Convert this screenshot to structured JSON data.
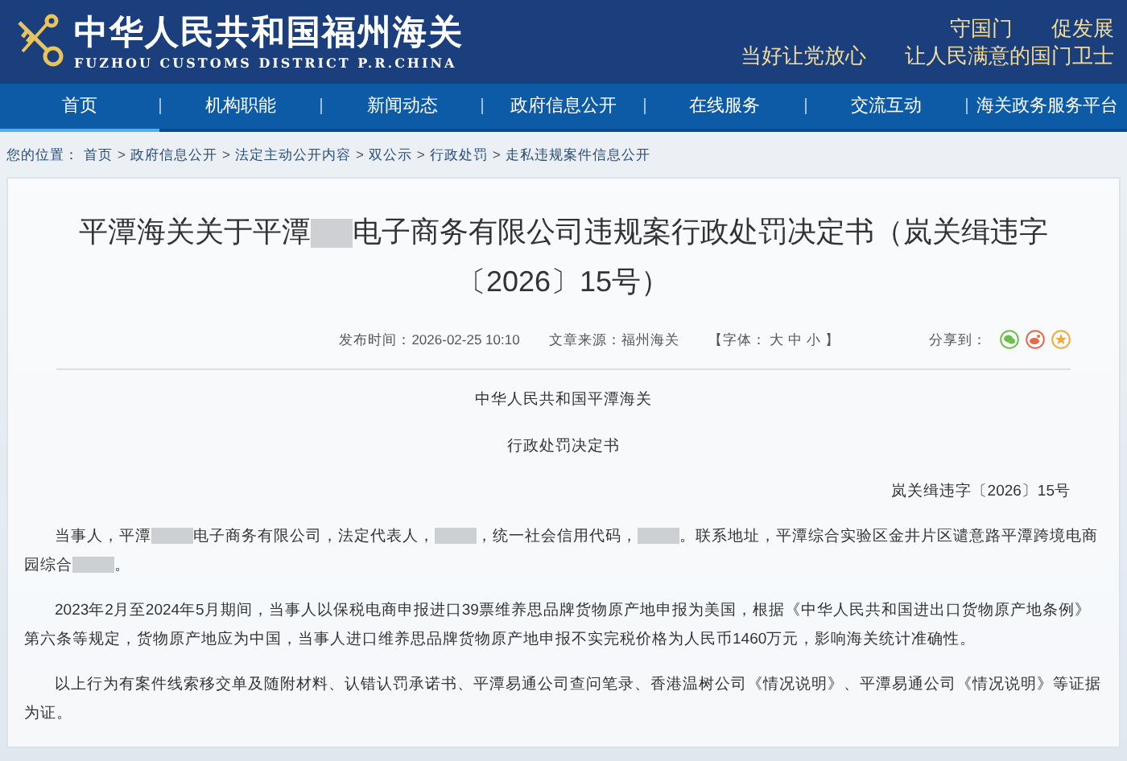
{
  "header": {
    "title": "中华人民共和国福州海关",
    "subtitle": "FUZHOU CUSTOMS DISTRICT P.R.CHINA",
    "slogans": [
      [
        "守国门",
        "促发展"
      ],
      [
        "当好让党放心",
        "让人民满意的国门卫士"
      ]
    ]
  },
  "nav": [
    {
      "label": "首页",
      "selected": true
    },
    {
      "label": "机构职能",
      "selected": false
    },
    {
      "label": "新闻动态",
      "selected": false
    },
    {
      "label": "政府信息公开",
      "selected": false
    },
    {
      "label": "在线服务",
      "selected": false
    },
    {
      "label": "交流互动",
      "selected": false
    },
    {
      "label": "海关政务服务平台",
      "selected": false
    }
  ],
  "breadcrumb": {
    "prefix": "您的位置：",
    "separator": ">",
    "items": [
      "首页",
      "政府信息公开",
      "法定主动公开内容",
      "双公示",
      "行政处罚",
      "走私违规案件信息公开"
    ]
  },
  "article": {
    "title": [
      {
        "kind": "text",
        "text": "平潭海关关于平潭"
      },
      {
        "kind": "redacted"
      },
      {
        "kind": "text",
        "text": "电子商务有限公司违规案行政处罚决定书（岚关缉违字〔2026〕15号）"
      }
    ],
    "meta": {
      "published": "发布时间：2026-02-25 10:10",
      "source": "文章来源：福州海关",
      "font_size": "【字体： 大 中 小 】",
      "share": "分享到："
    },
    "heading_lines": [
      "中华人民共和国平潭海关",
      "行政处罚决定书"
    ],
    "doc_number": "岚关缉违字〔2026〕15号",
    "paragraphs": [
      [
        {
          "kind": "text",
          "text": "当事人，平潭"
        },
        {
          "kind": "redacted"
        },
        {
          "kind": "text",
          "text": "电子商务有限公司，法定代表人，"
        },
        {
          "kind": "redacted"
        },
        {
          "kind": "text",
          "text": "，统一社会信用代码，"
        },
        {
          "kind": "redacted"
        },
        {
          "kind": "text",
          "text": "。联系地址，平潭综合实验区金井片区谴意路平潭跨境电商园综合"
        },
        {
          "kind": "redacted"
        },
        {
          "kind": "text",
          "text": "。"
        }
      ],
      [
        {
          "kind": "text",
          "text": "2023年2月至2024年5月期间，当事人以保税电商申报进口39票维养思品牌货物原产地申报为美国，根据《中华人民共和国进出口货物原产地条例》第六条等规定，货物原产地应为中国，当事人进口维养思品牌货物原产地申报不实完税价格为人民币1460万元，影响海关统计准确性。"
        }
      ],
      [
        {
          "kind": "text",
          "text": "以上行为有案件线索移交单及随附材料、认错认罚承诺书、平潭易通公司查问笔录、香港温树公司《情况说明》、平潭易通公司《情况说明》等证据为证。"
        }
      ]
    ]
  }
}
